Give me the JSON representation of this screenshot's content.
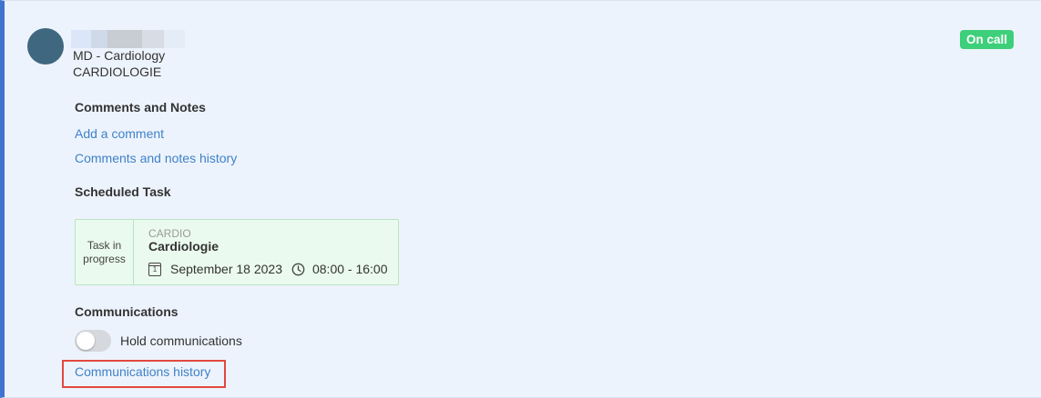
{
  "header": {
    "title": "MD - Cardiology",
    "department": "CARDIOLOGIE",
    "status_badge": "On call"
  },
  "comments": {
    "section_title": "Comments and Notes",
    "add_comment_link": "Add a comment",
    "history_link": "Comments and notes history"
  },
  "scheduled_task": {
    "section_title": "Scheduled Task",
    "status": "Task in progress",
    "code": "CARDIO",
    "name": "Cardiologie",
    "date": "September 18 2023",
    "time": "08:00 - 16:00",
    "calendar_day": "1"
  },
  "communications": {
    "section_title": "Communications",
    "hold_label": "Hold communications",
    "hold_enabled": false,
    "history_link": "Communications history"
  },
  "colors": {
    "accent": "#3f73cf",
    "link": "#3f82c8",
    "badge": "#3ecf7a",
    "highlight": "#e2483f"
  },
  "icons": [
    "avatar",
    "calendar-icon",
    "clock-icon"
  ]
}
